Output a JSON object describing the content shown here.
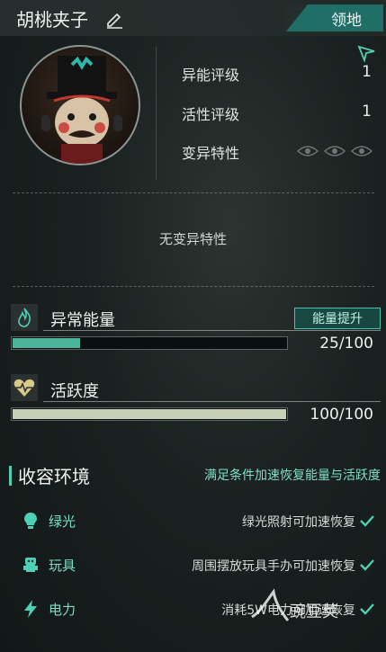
{
  "header": {
    "name": "胡桃夹子",
    "territory_label": "领地"
  },
  "stats": [
    {
      "label": "异能评级",
      "value": "1"
    },
    {
      "label": "活性评级",
      "value": "1"
    },
    {
      "label": "变异特性",
      "value": ""
    }
  ],
  "no_trait_text": "无变异特性",
  "energy": {
    "title": "异常能量",
    "value": "25/100",
    "fill_fraction": 0.25,
    "boost_label": "能量提升",
    "color": "#4bb59b"
  },
  "activity": {
    "title": "活跃度",
    "value": "100/100",
    "fill_fraction": 1.0,
    "color": "#c9cfb4"
  },
  "containment": {
    "title": "收容环境",
    "note": "满足条件加速恢复能量与活跃度",
    "items": [
      {
        "icon": "bulb-icon",
        "name": "绿光",
        "desc": "绿光照射可加速恢复"
      },
      {
        "icon": "toy-icon",
        "name": "玩具",
        "desc": "周围摆放玩具手办可加速恢复"
      },
      {
        "icon": "lightning-icon",
        "name": "电力",
        "desc": "消耗5W电力可加速恢复"
      }
    ]
  },
  "watermark": "豌豆荚",
  "colors": {
    "accent": "#4fd0b4",
    "territory_bg": "#1f6f66"
  }
}
